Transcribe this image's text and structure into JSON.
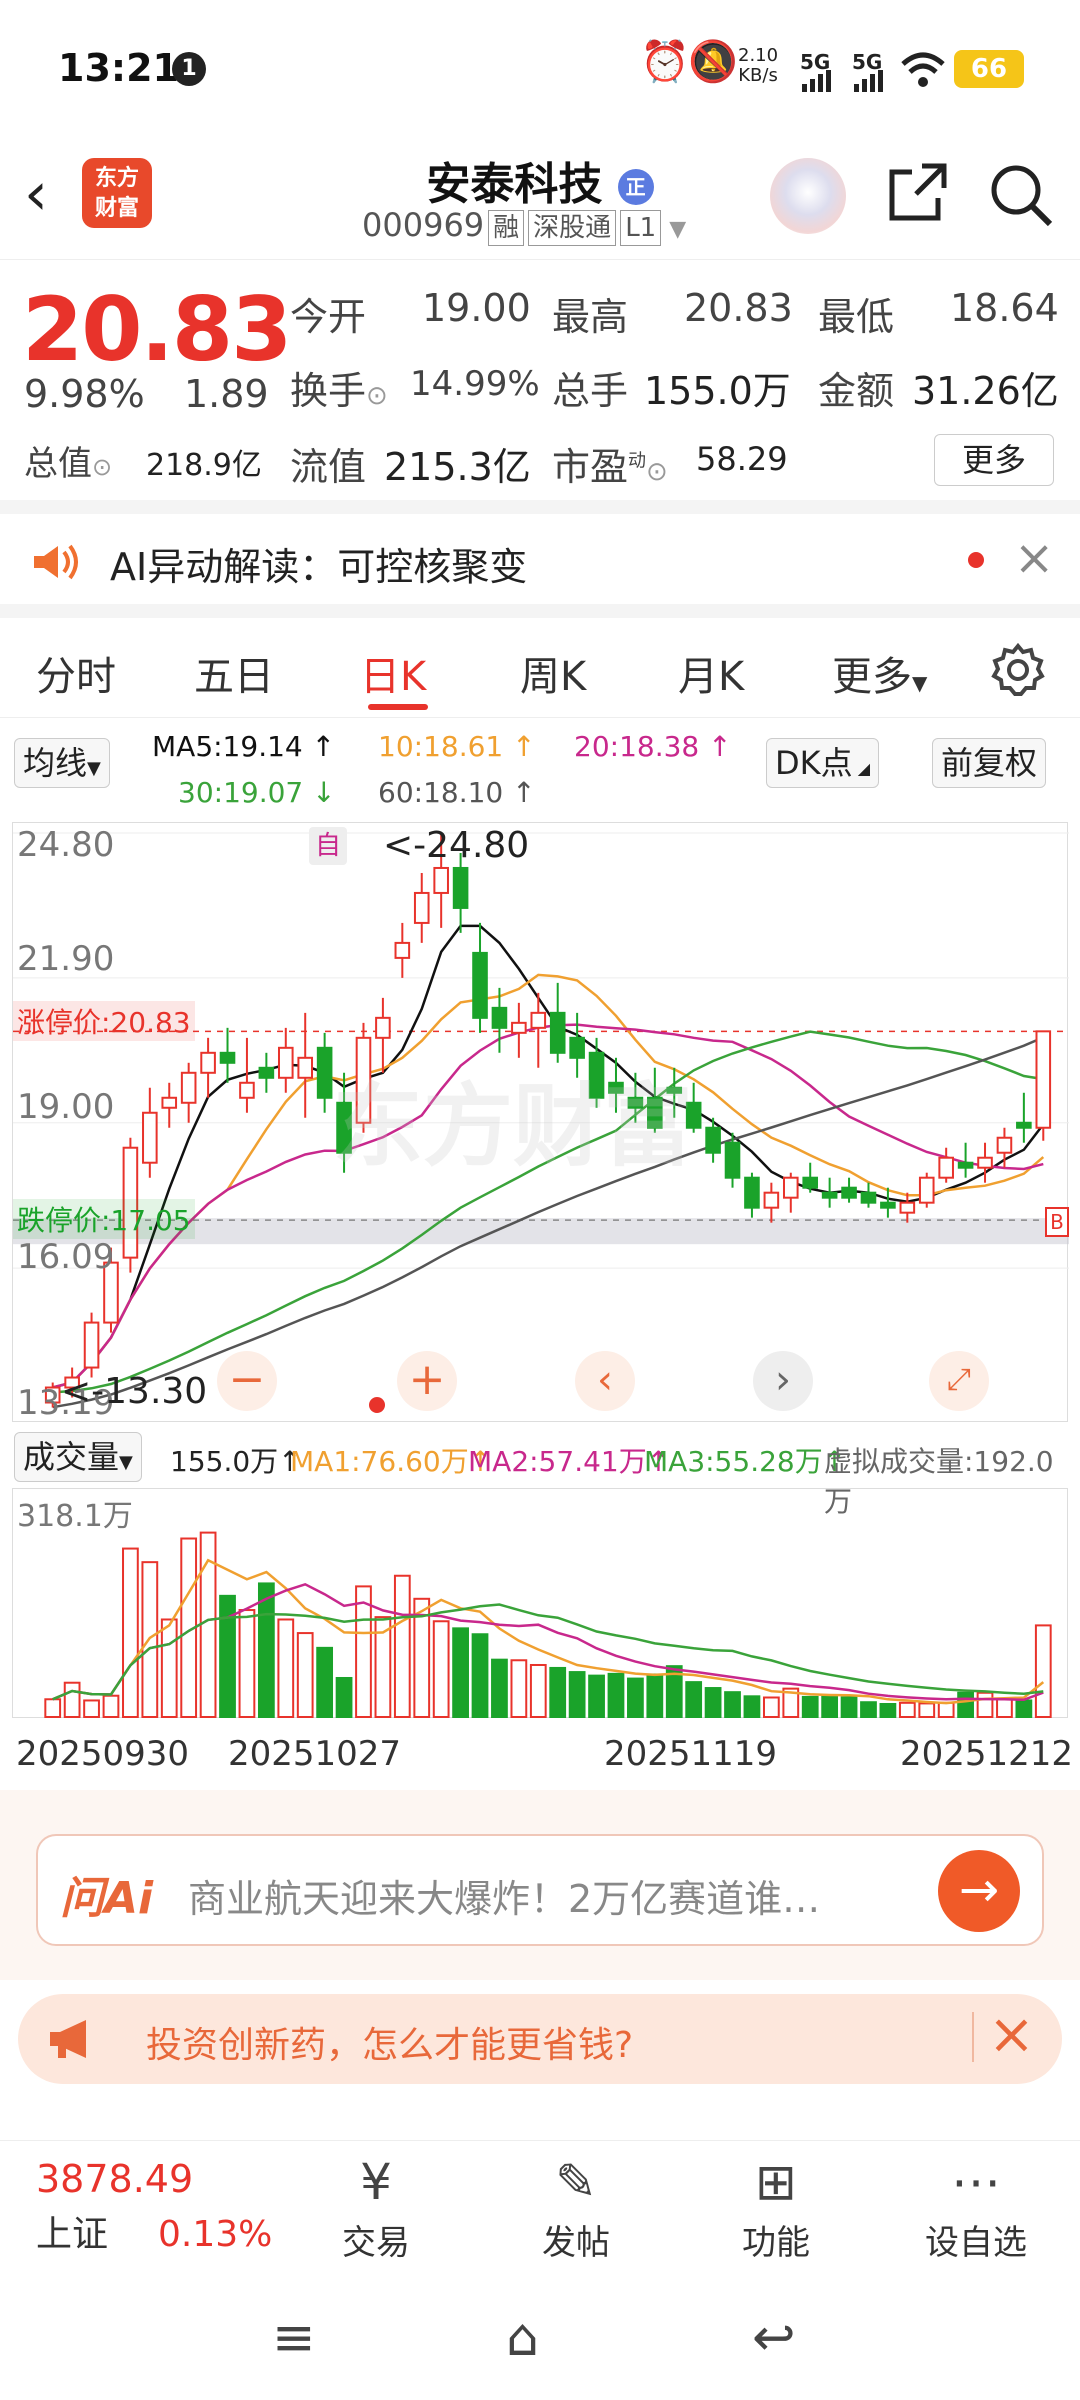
{
  "status_bar": {
    "time": "13:21",
    "notif_count": "1",
    "net_speed_top": "2.10",
    "net_speed_bottom": "KB/s",
    "sig1": "5G",
    "sig2": "5G",
    "battery": "66"
  },
  "header": {
    "logo_top": "东方",
    "logo_bottom": "财富",
    "title": "安泰科技",
    "title_badge": "正",
    "code": "000969",
    "tag1": "融",
    "tag2": "深股通",
    "tag3": "L1"
  },
  "quote": {
    "price": "20.83",
    "change_pct": "9.98%",
    "change_amt": "1.89",
    "open_label": "今开",
    "open": "19.00",
    "high_label": "最高",
    "high": "20.83",
    "low_label": "最低",
    "low": "18.64",
    "turnover_label": "换手",
    "turnover": "14.99%",
    "volume_label": "总手",
    "volume": "155.0万",
    "amount_label": "金额",
    "amount": "31.26亿",
    "mktcap_label": "总值",
    "mktcap": "218.9亿",
    "float_label": "流值",
    "float": "215.3亿",
    "pe_label": "市盈",
    "pe_sup": "动",
    "pe": "58.29",
    "more": "更多"
  },
  "ai_alert": {
    "text": "AI异动解读：可控核聚变"
  },
  "tabs": [
    "分时",
    "五日",
    "日K",
    "周K",
    "月K",
    "更多"
  ],
  "ma_row": {
    "select": "均线",
    "ma5": "MA5:19.14 ↑",
    "ma10": "10:18.61 ↑",
    "ma20": "20:18.38 ↑",
    "ma30": "30:19.07 ↓",
    "ma60": "60:18.10 ↑",
    "dk": "DK点",
    "adj": "前复权"
  },
  "kchart": {
    "y_top": "24.80",
    "y2": "21.90",
    "y3": "19.00",
    "y4": "16.09",
    "y_bottom": "13.19",
    "high_marker": "<-24.80",
    "low_marker": "<-13.30",
    "self_tag": "自",
    "limit_up": "涨停价:20.83",
    "limit_down": "跌停价:17.05",
    "watermark": "东方财富",
    "b_tag": "B"
  },
  "chart_data": {
    "type": "candlestick",
    "candles": [
      [
        13.4,
        13.8,
        13.3,
        13.7
      ],
      [
        13.7,
        14.1,
        13.5,
        13.9
      ],
      [
        14.1,
        15.2,
        13.9,
        15.0
      ],
      [
        15.0,
        16.5,
        14.8,
        16.2
      ],
      [
        16.3,
        18.7,
        16.0,
        18.5
      ],
      [
        18.2,
        19.7,
        17.9,
        19.2
      ],
      [
        19.3,
        19.8,
        18.9,
        19.5
      ],
      [
        19.4,
        20.2,
        19.0,
        20.0
      ],
      [
        20.0,
        20.7,
        19.5,
        20.4
      ],
      [
        20.4,
        20.9,
        19.8,
        20.2
      ],
      [
        19.5,
        20.7,
        19.2,
        19.8
      ],
      [
        20.1,
        20.4,
        19.6,
        19.9
      ],
      [
        19.9,
        20.9,
        19.6,
        20.5
      ],
      [
        19.9,
        21.2,
        19.1,
        20.3
      ],
      [
        20.5,
        20.8,
        19.2,
        19.5
      ],
      [
        19.4,
        20.0,
        18.0,
        18.4
      ],
      [
        19.0,
        21.0,
        18.8,
        20.7
      ],
      [
        20.7,
        21.5,
        20.0,
        21.1
      ],
      [
        22.3,
        23.0,
        21.9,
        22.6
      ],
      [
        23.0,
        24.0,
        22.6,
        23.6
      ],
      [
        23.6,
        24.8,
        22.9,
        24.1
      ],
      [
        24.1,
        24.4,
        22.8,
        23.3
      ],
      [
        22.4,
        23.0,
        20.8,
        21.1
      ],
      [
        21.3,
        21.7,
        20.4,
        20.9
      ],
      [
        20.8,
        21.4,
        20.3,
        21.0
      ],
      [
        20.9,
        21.6,
        20.1,
        21.2
      ],
      [
        21.2,
        21.8,
        20.2,
        20.4
      ],
      [
        20.7,
        21.2,
        19.9,
        20.3
      ],
      [
        20.4,
        20.7,
        19.3,
        19.5
      ],
      [
        19.8,
        20.3,
        19.2,
        19.6
      ],
      [
        19.5,
        20.0,
        19.0,
        19.3
      ],
      [
        19.5,
        20.1,
        18.8,
        18.9
      ],
      [
        19.7,
        20.1,
        19.1,
        19.6
      ],
      [
        19.4,
        19.8,
        18.8,
        18.9
      ],
      [
        18.9,
        19.1,
        18.2,
        18.4
      ],
      [
        18.6,
        18.8,
        17.7,
        17.9
      ],
      [
        17.9,
        18.0,
        17.1,
        17.3
      ],
      [
        17.3,
        17.8,
        17.0,
        17.6
      ],
      [
        17.5,
        18.0,
        17.2,
        17.9
      ],
      [
        17.9,
        18.2,
        17.6,
        17.7
      ],
      [
        17.6,
        17.9,
        17.3,
        17.5
      ],
      [
        17.7,
        17.9,
        17.4,
        17.5
      ],
      [
        17.6,
        17.8,
        17.3,
        17.4
      ],
      [
        17.4,
        17.7,
        17.1,
        17.3
      ],
      [
        17.2,
        17.6,
        17.0,
        17.4
      ],
      [
        17.4,
        18.0,
        17.3,
        17.9
      ],
      [
        17.9,
        18.5,
        17.8,
        18.3
      ],
      [
        18.2,
        18.6,
        17.9,
        18.1
      ],
      [
        18.1,
        18.6,
        17.8,
        18.3
      ],
      [
        18.4,
        18.9,
        18.1,
        18.7
      ],
      [
        19.0,
        19.6,
        18.6,
        18.9
      ],
      [
        18.9,
        20.83,
        18.64,
        20.83
      ]
    ],
    "ylim": [
      13.19,
      24.8
    ],
    "volume": [
      30,
      58,
      28,
      36,
      285,
      262,
      165,
      302,
      312,
      205,
      181,
      226,
      165,
      142,
      117,
      66,
      221,
      169,
      239,
      200,
      162,
      150,
      140,
      97,
      96,
      88,
      83,
      76,
      70,
      73,
      65,
      72,
      86,
      59,
      49,
      42,
      35,
      33,
      48,
      34,
      36,
      33,
      25,
      22,
      24,
      23,
      24,
      41,
      41,
      30,
      28,
      155
    ],
    "volume_top": "318.1万",
    "vol_select": "成交量",
    "vol_val": "155.0万↑",
    "vol_ma1": "MA1:76.60万↑",
    "vol_ma2": "MA2:57.41万↑",
    "vol_ma3": "MA3:55.28万↑",
    "vol_virtual": "虚拟成交量:192.0万",
    "dates": [
      "20250930",
      "20251027",
      "20251119",
      "20251212"
    ]
  },
  "ask_bar": {
    "brand": "问Ai",
    "text": "商业航天迎来大爆炸！2万亿赛道谁…"
  },
  "promo": {
    "text": "投资创新药，怎么才能更省钱?"
  },
  "bottom_bar": {
    "index_value": "3878.49",
    "index_name": "上证",
    "index_pct": "0.13%",
    "trade": "交易",
    "post": "发帖",
    "func": "功能",
    "add": "设自选"
  },
  "colors": {
    "up": "#e8332b",
    "down": "#1aa32a",
    "ma5": "#111111",
    "ma10": "#f0a030",
    "ma20": "#c8288c",
    "ma30": "#3aa33a",
    "ma60": "#555555"
  }
}
